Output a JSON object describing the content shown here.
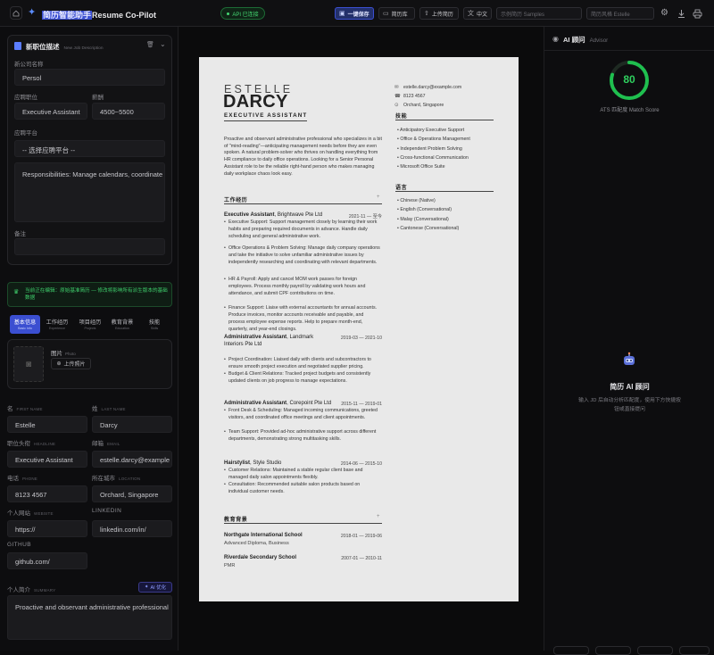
{
  "app": {
    "title_cn": "简历智能助手",
    "title_en": "Resume Co-Pilot",
    "api_status": "API 已连接"
  },
  "toolbar": {
    "save": "一键保存",
    "library": "简历库",
    "upload": "上传简历",
    "lang": "中文",
    "sample": "示例简历 Samples",
    "style": "简历风格 Estelle"
  },
  "jd": {
    "title": "新职位描述",
    "subtitle": "New Job Description",
    "company_label": "新公司名称",
    "company_value": "Persol",
    "position_label": "应聘职位",
    "position_value": "Executive Assistant",
    "salary_label": "薪酬",
    "salary_value": "4500~5500",
    "platform_label": "应聘平台",
    "platform_value": "-- 选择应聘平台 --",
    "responsibilities": "Responsibilities:  Manage calendars, coordinate",
    "notes_label": "备注",
    "notes_value": ""
  },
  "notice": "当前正在编辑：原始基准简历 — 修改将影响所有派生版本的基础数据",
  "tabs": [
    {
      "cn": "基本信息",
      "en": "Basic Info"
    },
    {
      "cn": "工作经历",
      "en": "Experience"
    },
    {
      "cn": "项目经历",
      "en": "Projects"
    },
    {
      "cn": "教育背景",
      "en": "Education"
    },
    {
      "cn": "技能",
      "en": "Skills"
    }
  ],
  "photo": {
    "label": "图片",
    "label_en": "Photo",
    "upload": "上传照片"
  },
  "form": {
    "first_name_label": "名",
    "first_name_en": "FIRST NAME",
    "first_name": "Estelle",
    "last_name_label": "姓",
    "last_name_en": "LAST NAME",
    "last_name": "Darcy",
    "headline_label": "职位头衔",
    "headline_en": "HEADLINE",
    "headline": "Executive Assistant",
    "email_label": "邮箱",
    "email_en": "EMAIL",
    "email": "estelle.darcy@example",
    "phone_label": "电话",
    "phone_en": "PHONE",
    "phone": "8123 4567",
    "location_label": "所在城市",
    "location_en": "LOCATION",
    "location": "Orchard, Singapore",
    "website_label": "个人网站",
    "website_en": "WEBSITE",
    "website": "https://",
    "linkedin_label": "LINKEDIN",
    "linkedin": "linkedin.com/in/",
    "github_label": "GITHUB",
    "github": "github.com/",
    "summary_label": "个人简介",
    "summary_en": "SUMMARY",
    "ai_button": "AI 优化",
    "summary": "Proactive and observant administrative professional"
  },
  "resume": {
    "first": "ESTELLE",
    "last": "DARCY",
    "headline": "EXECUTIVE ASSISTANT",
    "email": "estelle.darcy@example.com",
    "phone": "8123 4567",
    "location": "Orchard, Singapore",
    "summary": "Proactive and observant administrative professional who specializes in a bit of \"mind-reading\"—anticipating management needs before they are even spoken. A natural problem-solver who thrives on handling everything from HR compliance to daily office operations. Looking for a Senior Personal Assistant role to be the reliable right-hand person who makes managing daily workplace chaos look easy.",
    "work_heading": "工作经历",
    "jobs": [
      {
        "title": "Executive Assistant",
        "company": ", Brightwave Pte Ltd",
        "dates": "2021-11 — 至今",
        "bullets": [
          "Executive Support: Support management closely by learning their work habits and preparing required documents in advance. Handle daily scheduling and general administrative work.",
          "Office Operations & Problem Solving: Manage daily company operations and take the initiative to solve unfamiliar administrative issues by independently researching and coordinating with relevant departments.",
          "HR & Payroll: Apply and cancel MOM work passes for foreign employees. Process monthly payroll by validating work hours and attendance, and submit CPF contributions on time.",
          "Finance Support: Liaise with external accountants for annual accounts. Produce invoices, monitor accounts receivable and payable, and process employee expense reports. Help to prepare month-end, quarterly, and year-end closings."
        ]
      },
      {
        "title": "Administrative Assistant",
        "company": ", Landmark",
        "company2": "Interiors Pte Ltd",
        "dates": "2019-03 — 2021-10",
        "bullets": [
          "Project Coordination: Liaised daily with clients and subcontractors to ensure smooth project execution and negotiated supplier pricing.",
          "Budget & Client Relations: Tracked project budgets and consistently updated clients on job progress to manage expectations."
        ]
      },
      {
        "title": "Administrative Assistant",
        "company": ", Corepoint Pte Ltd",
        "dates": "2015-11 — 2019-01",
        "bullets": [
          "Front Desk & Scheduling: Managed incoming communications, greeted visitors, and coordinated office meetings and client appointments.",
          "Team Support: Provided ad-hoc administrative support across different departments, demonstrating strong multitasking skills."
        ]
      },
      {
        "title": "Hairstylist",
        "company": ", Style Studio",
        "dates": "2014-06 — 2015-10",
        "bullets": [
          "Customer Relations: Maintained a stable regular client base and managed daily salon appointments flexibly.",
          "Consultation: Recommended suitable salon products based on individual customer needs."
        ]
      }
    ],
    "edu_heading": "教育背景",
    "edu": [
      {
        "school": "Northgate International School",
        "degree": "Advanced Diploma, Business",
        "dates": "2018-01 — 2019-06"
      },
      {
        "school": "Riverdale Secondary School",
        "degree": "PMR",
        "dates": "2007-01 — 2010-11"
      }
    ],
    "skills_heading": "技能",
    "skills": [
      "Anticipatory Executive Support",
      "Office & Operations Management",
      "Independent Problem Solving",
      "Cross-functional Communication",
      "Microsoft Office Suite"
    ],
    "lang_heading": "语言",
    "languages": [
      "Chinese (Native)",
      "English (Conversational)",
      "Malay (Conversational)",
      "Cantonese (Conversational)"
    ]
  },
  "advisor": {
    "title": "AI 顾问",
    "title_en": "Advisor",
    "score": 80,
    "score_fraction": 0.8,
    "score_label": "ATS 匹配度 Match Score",
    "heading": "简历 AI 顾问",
    "desc1": "输入 JD 后自动分析匹配度，使用下方快捷按",
    "desc2": "钮或直接提问"
  },
  "colors": {
    "accent": "#1fbf4f",
    "brand": "#4f7cff",
    "save_bg": "#23306a"
  }
}
